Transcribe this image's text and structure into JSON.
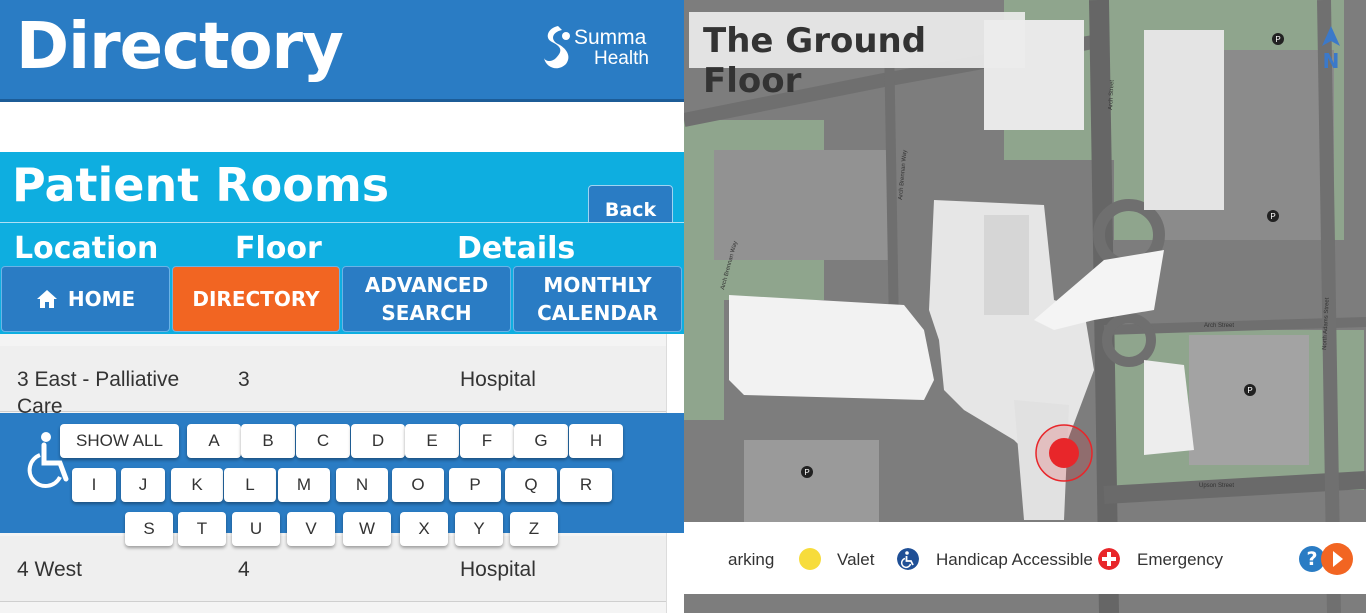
{
  "header": {
    "title": "Directory",
    "logo_line1": "Summa",
    "logo_line2": "Health"
  },
  "section": {
    "title": "Patient Rooms",
    "back_label": "Back"
  },
  "columns": [
    "Location",
    "Floor",
    "Details"
  ],
  "nav": [
    {
      "label": "HOME",
      "icon": "home-icon"
    },
    {
      "label": "DIRECTORY"
    },
    {
      "label_line1": "ADVANCED",
      "label_line2": "SEARCH"
    },
    {
      "label_line1": "MONTHLY",
      "label_line2": "CALENDAR"
    }
  ],
  "rows": [
    {
      "location": "3 East - Palliative Care",
      "floor": "3",
      "details": "Hospital"
    },
    {
      "location": "4 West",
      "floor": "4",
      "details": "Hospital"
    }
  ],
  "keyboard": {
    "show_all": "SHOW ALL",
    "row1": [
      "A",
      "B",
      "C",
      "D",
      "E",
      "F",
      "G",
      "H"
    ],
    "row2": [
      "I",
      "J",
      "K",
      "L",
      "M",
      "N",
      "O",
      "P",
      "Q",
      "R"
    ],
    "row3": [
      "S",
      "T",
      "U",
      "V",
      "W",
      "X",
      "Y",
      "Z"
    ],
    "accessibility_icon": "wheelchair-icon"
  },
  "map": {
    "title": "The Ground Floor",
    "compass_label": "N",
    "streets": [
      "Arch Street",
      "Arch Street",
      "Arch Brennan Way",
      "Arch Brennan Way",
      "North Adams Street",
      "Upson Street"
    ],
    "parking_label": "P"
  },
  "legend": {
    "items": [
      {
        "label": "arking",
        "icon": "parking-icon"
      },
      {
        "label": "Valet",
        "icon": "valet-dot-icon"
      },
      {
        "label": "Handicap Accessible",
        "icon": "wheelchair-icon"
      },
      {
        "label": "Emergency",
        "icon": "emergency-cross-icon"
      }
    ],
    "help_label": "?"
  },
  "colors": {
    "header_blue": "#2a7cc4",
    "band_cyan": "#0eaee0",
    "active_orange": "#f26522",
    "marker_red": "#e8262a"
  }
}
